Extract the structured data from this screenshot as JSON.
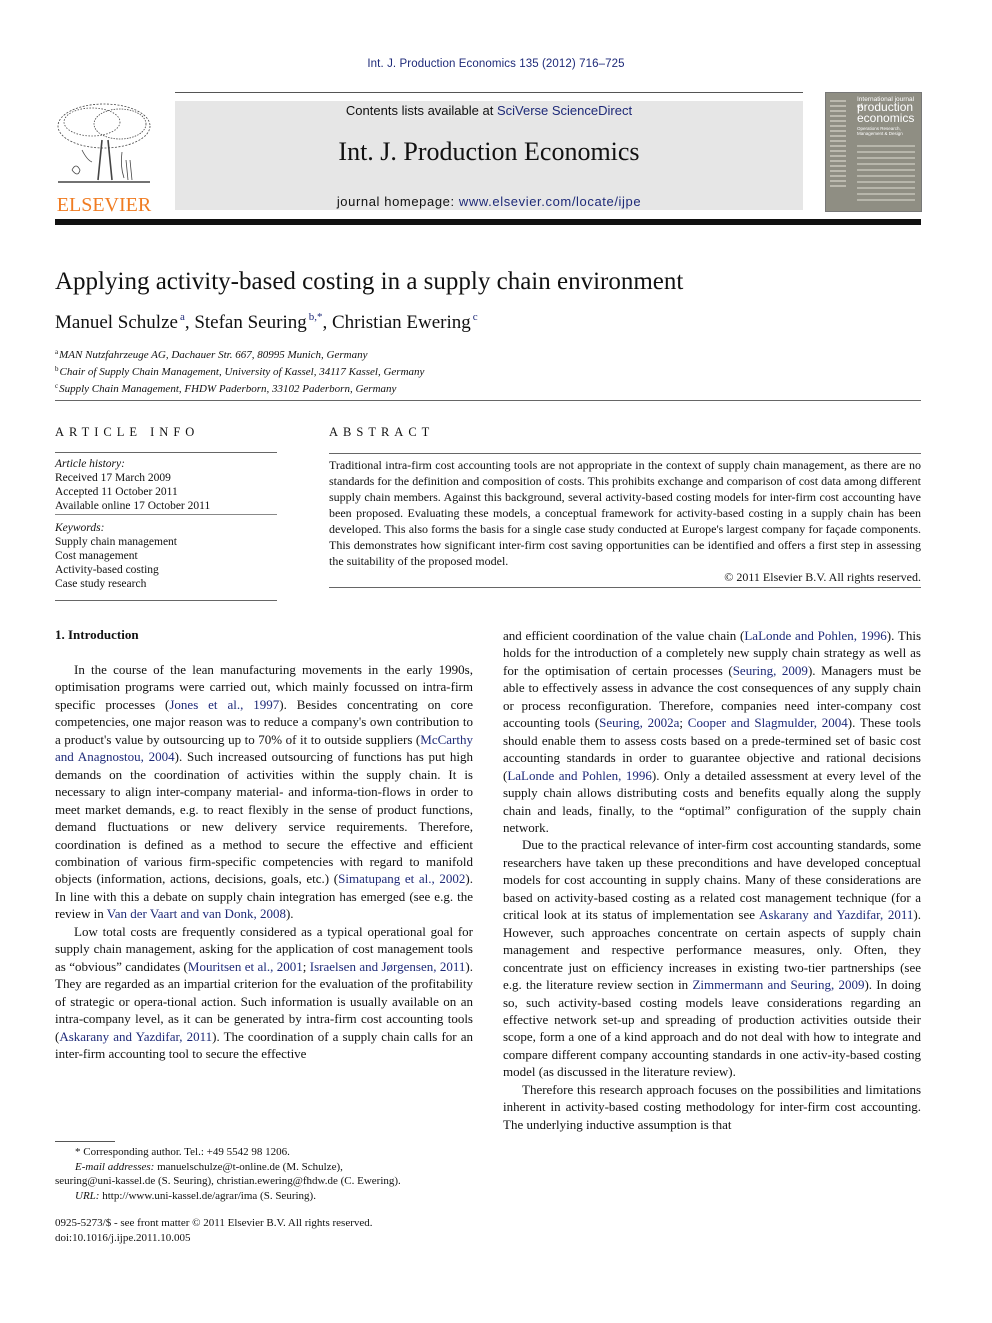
{
  "header": {
    "citation": "Int. J. Production Economics 135 (2012) 716–725",
    "publisher_logo_text": "ELSEVIER",
    "contents_prefix": "Contents lists available at ",
    "contents_link": "SciVerse ScienceDirect",
    "journal_name": "Int. J. Production Economics",
    "homepage_prefix": "journal homepage: ",
    "homepage_link": "www.elsevier.com/locate/ijpe",
    "cover": {
      "line1": "International journal of",
      "line2": "production",
      "line3": "economics",
      "line4": "Operations Research, Management & Design"
    },
    "colors": {
      "link": "#1e2a78",
      "elsevier_orange": "#f07c22",
      "banner_bg": "#e6e6e6",
      "cover_bg": "#8f8e83"
    }
  },
  "article": {
    "title": "Applying activity-based costing in a supply chain environment",
    "authors": [
      {
        "name": "Manuel Schulze",
        "sup": "a"
      },
      {
        "name": "Stefan Seuring",
        "sup": "b,*"
      },
      {
        "name": "Christian Ewering",
        "sup": "c"
      }
    ],
    "separator": ", ",
    "affiliations": [
      {
        "sup": "a",
        "text": "MAN Nutzfahrzeuge AG, Dachauer Str. 667, 80995 Munich, Germany"
      },
      {
        "sup": "b",
        "text": "Chair of Supply Chain Management, University of Kassel, 34117 Kassel, Germany"
      },
      {
        "sup": "c",
        "text": "Supply Chain Management, FHDW Paderborn, 33102 Paderborn, Germany"
      }
    ]
  },
  "article_info": {
    "heading": "ARTICLE INFO",
    "history_label": "Article history:",
    "history": [
      "Received 17 March 2009",
      "Accepted 11 October 2011",
      "Available online 17 October 2011"
    ],
    "keywords_label": "Keywords:",
    "keywords": [
      "Supply chain management",
      "Cost management",
      "Activity-based costing",
      "Case study research"
    ]
  },
  "abstract": {
    "heading": "ABSTRACT",
    "text": "Traditional intra-firm cost accounting tools are not appropriate in the context of supply chain management, as there are no standards for the definition and composition of costs. This prohibits exchange and comparison of cost data among different supply chain members. Against this background, several activity-based costing models for inter-firm cost accounting have been proposed. Evaluating these models, a conceptual framework for activity-based costing in a supply chain has been developed. This also forms the basis for a single case study conducted at Europe's largest company for façade components. This demonstrates how significant inter-firm cost saving opportunities can be identified and offers a first step in assessing the suitability of the proposed model.",
    "copyright": "© 2011 Elsevier B.V. All rights reserved."
  },
  "body": {
    "section_heading": "1.  Introduction",
    "left_paragraphs": [
      [
        {
          "t": "In the course of the lean manufacturing movements in the early 1990s, optimisation programs were carried out, which mainly focussed on intra-firm specific processes ("
        },
        {
          "t": "Jones et al., 1997",
          "link": true
        },
        {
          "t": "). Besides concentrating on core competencies, one major reason was to reduce a company's own contribution to a product's value by outsourcing up to 70% of it to outside suppliers ("
        },
        {
          "t": "McCarthy and Anagnostou, 2004",
          "link": true
        },
        {
          "t": "). Such increased outsourcing of functions has put high demands on the coordination of activities within the supply chain. It is necessary to align inter-company material- and informa-tion-flows in order to meet market demands, e.g. to react flexibly in the sense of product functions, demand fluctuations or new delivery service requirements. Therefore, coordination is defined as a method to secure the effective and efficient combination of various firm-specific competencies with regard to manifold objects (information, actions, decisions, goals, etc.) ("
        },
        {
          "t": "Simatupang et al., 2002",
          "link": true
        },
        {
          "t": "). In line with this a debate on supply chain integration has emerged (see e.g. the review in "
        },
        {
          "t": "Van der Vaart and van Donk, 2008",
          "link": true
        },
        {
          "t": ")."
        }
      ],
      [
        {
          "t": "Low total costs are frequently considered as a typical operational goal for supply chain management, asking for the application of cost management tools as “obvious” candidates ("
        },
        {
          "t": "Mouritsen et al., 2001",
          "link": true
        },
        {
          "t": "; "
        },
        {
          "t": "Israelsen and Jørgensen, 2011",
          "link": true
        },
        {
          "t": "). They are regarded as an impartial criterion for the evaluation of the profitability of strategic or opera-tional action. Such information is usually available on an intra-company level, as it can be generated by intra-firm cost accounting tools ("
        },
        {
          "t": "Askarany and Yazdifar, 2011",
          "link": true
        },
        {
          "t": "). The coordination of a supply chain calls for an inter-firm accounting tool to secure the effective"
        }
      ]
    ],
    "right_paragraphs": [
      [
        {
          "t": "and efficient coordination of the value chain ("
        },
        {
          "t": "LaLonde and Pohlen, 1996",
          "link": true
        },
        {
          "t": "). This holds for the introduction of a completely new supply chain strategy as well as for the optimisation of certain processes ("
        },
        {
          "t": "Seuring, 2009",
          "link": true
        },
        {
          "t": "). Managers must be able to effectively assess in advance the cost consequences of any supply chain or process reconfiguration. Therefore, companies need inter-company cost accounting tools ("
        },
        {
          "t": "Seuring, 2002a",
          "link": true
        },
        {
          "t": "; "
        },
        {
          "t": "Cooper and Slagmulder, 2004",
          "link": true
        },
        {
          "t": "). These tools should enable them to assess costs based on a prede-termined set of basic cost accounting standards in order to guarantee objective and rational decisions ("
        },
        {
          "t": "LaLonde and Pohlen, 1996",
          "link": true
        },
        {
          "t": "). Only a detailed assessment at every level of the supply chain allows distributing costs and benefits equally along the supply chain and leads, finally, to the “optimal” configuration of the supply chain network."
        }
      ],
      [
        {
          "t": "Due to the practical relevance of inter-firm cost accounting standards, some researchers have taken up these preconditions and have developed conceptual models for cost accounting in supply chains. Many of these considerations are based on activity-based costing as a related cost management technique (for a critical look at its status of implementation see "
        },
        {
          "t": "Askarany and Yazdifar, 2011",
          "link": true
        },
        {
          "t": "). However, such approaches concentrate on certain aspects of supply chain management and respective performance measures, only. Often, they concentrate just on efficiency increases in existing two-tier partnerships (see e.g. the literature review section in "
        },
        {
          "t": "Zimmermann and Seuring, 2009",
          "link": true
        },
        {
          "t": "). In doing so, such activity-based costing models leave considerations regarding an effective network set-up and spreading of production activities outside their scope, form a one of a kind approach and do not deal with how to integrate and compare different company accounting standards in one activ-ity-based costing model (as discussed in the literature review)."
        }
      ],
      [
        {
          "t": "Therefore this research approach focuses on the possibilities and limitations inherent in activity-based costing methodology for inter-firm cost accounting. The underlying inductive assumption is that"
        }
      ]
    ]
  },
  "footnotes": {
    "corresponding": "* Corresponding author. Tel.: +49 5542 98 1206.",
    "email_label": "E-mail addresses:",
    "email_line1": " manuelschulze@t-online.de (M. Schulze),",
    "email_line2": "seuring@uni-kassel.de (S. Seuring), christian.ewering@fhdw.de (C. Ewering).",
    "url_label": "URL:",
    "url_text": " http://www.uni-kassel.de/agrar/ima (S. Seuring).",
    "front_matter": "0925-5273/$ - see front matter © 2011 Elsevier B.V. All rights reserved.",
    "doi": "doi:10.1016/j.ijpe.2011.10.005"
  }
}
